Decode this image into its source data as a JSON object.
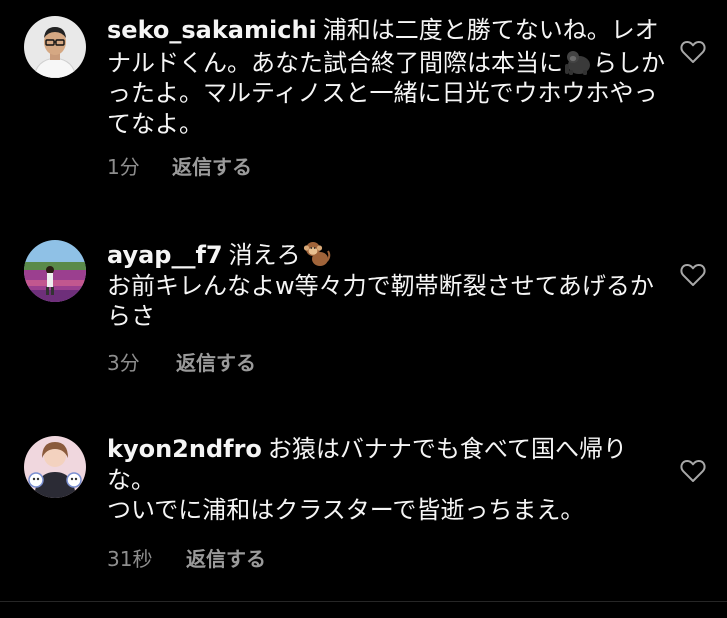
{
  "comments": [
    {
      "username": "seko_sakamichi",
      "text_before_emoji": "浦和は二度と勝てないね。レオナルドくん。あなた試合終了間際は本当に",
      "emoji": "gorilla-emoji",
      "text_after_emoji": "らしかったよ。マルティノスと一緒に日光でウホウホやってなよ。",
      "time": "1分",
      "reply_label": "返信する",
      "avatar": "man-with-glasses-avatar"
    },
    {
      "username": "ayap__f7",
      "text_before_emoji": "消えろ",
      "emoji": "monkey-emoji",
      "text_after_emoji": "お前キレんなよw等々力で靭帯断裂させてあげるからさ",
      "time": "3分",
      "reply_label": "返信する",
      "avatar": "flower-field-avatar"
    },
    {
      "username": "kyon2ndfro",
      "text_before_emoji": "お猿はバナナでも食べて国へ帰りな。",
      "emoji": "",
      "text_after_emoji": "ついでに浦和はクラスターで皆逝っちまえ。",
      "time": "31秒",
      "reply_label": "返信する",
      "avatar": "woman-with-mascots-avatar"
    }
  ],
  "colors": {
    "background": "#000000",
    "text": "#f5f5f5",
    "secondary": "#8e8e8e",
    "divider": "#262626"
  }
}
